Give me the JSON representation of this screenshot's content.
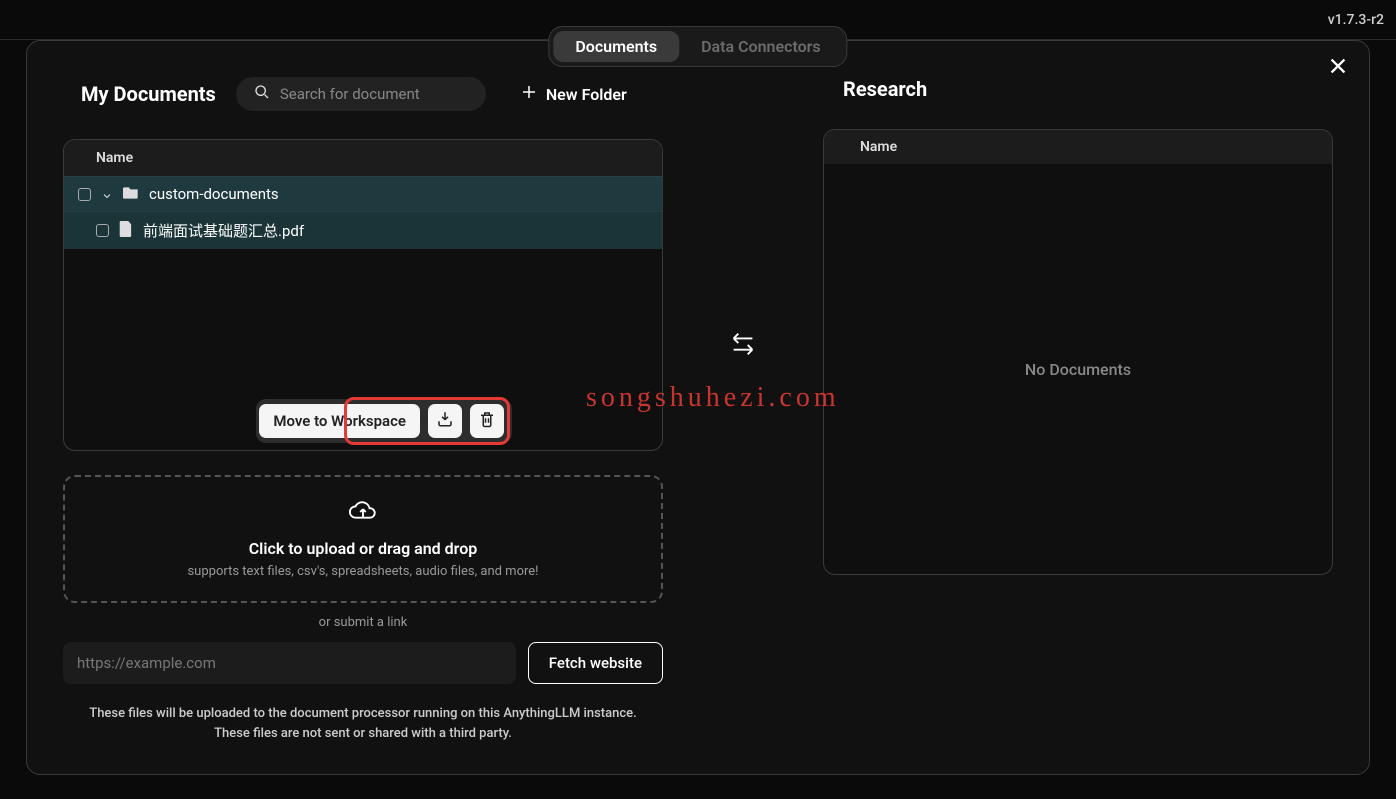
{
  "version": "v1.7.3-r2",
  "tabs": {
    "documents": "Documents",
    "connectors": "Data Connectors"
  },
  "left": {
    "title": "My Documents",
    "search_placeholder": "Search for document",
    "new_folder": "New Folder",
    "header": "Name",
    "folder": "custom-documents",
    "file": "前端面试基础题汇总.pdf",
    "move_btn": "Move to Workspace"
  },
  "upload": {
    "main": "Click to upload or drag and drop",
    "sub": "supports text files, csv's, spreadsheets, audio files, and more!",
    "or": "or submit a link",
    "url_placeholder": "https://example.com",
    "fetch": "Fetch website"
  },
  "footer": {
    "l1": "These files will be uploaded to the document processor running on this AnythingLLM instance.",
    "l2": "These files are not sent or shared with a third party."
  },
  "right": {
    "title": "Research",
    "header": "Name",
    "empty": "No Documents"
  },
  "watermark": "songshuhezi.com"
}
